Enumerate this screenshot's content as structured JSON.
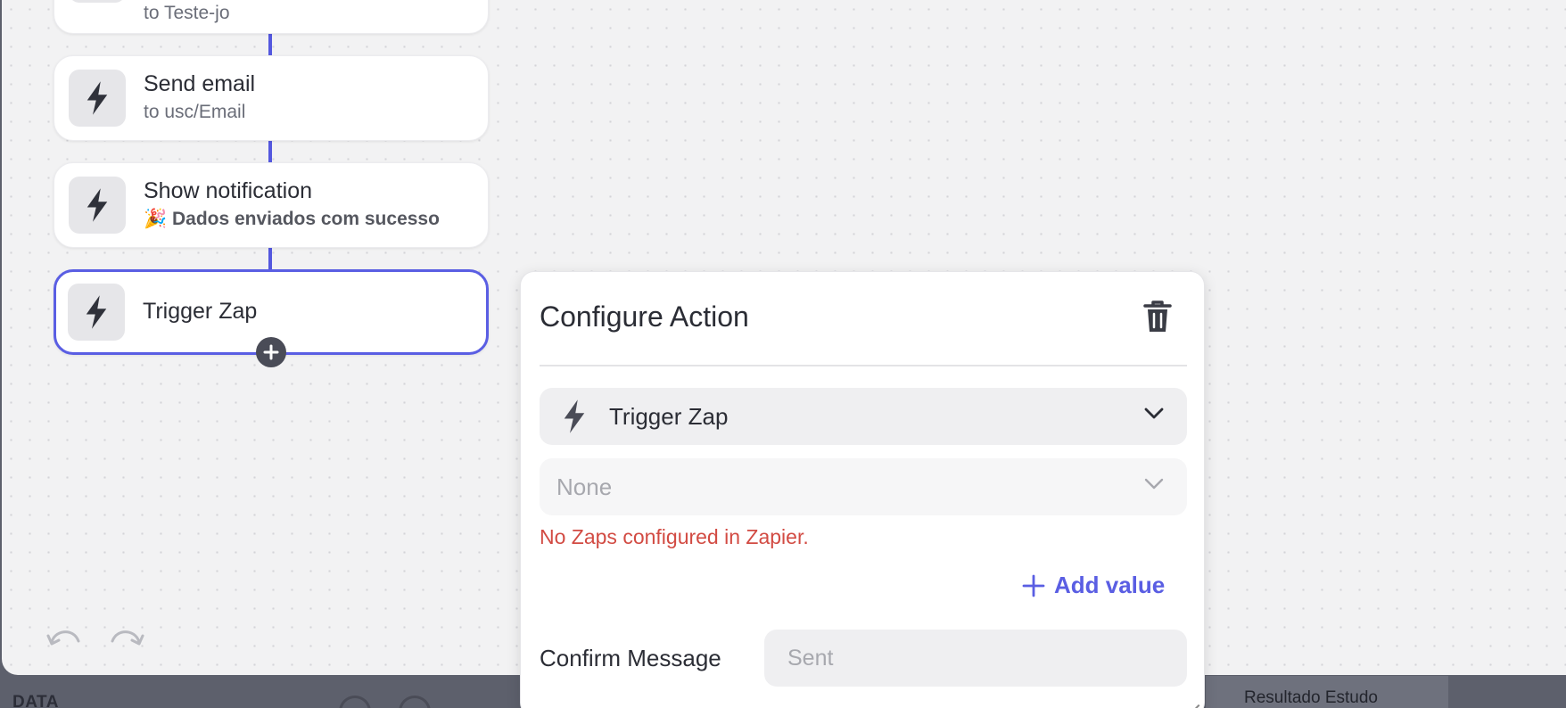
{
  "canvas": {
    "nodes": [
      {
        "title": "",
        "subtitle": "to Teste-jo"
      },
      {
        "title": "Send email",
        "subtitle": "to usc/Email"
      },
      {
        "title": "Show notification",
        "subtitle": "🎉 Dados enviados com sucesso"
      },
      {
        "title": "Trigger Zap",
        "subtitle": ""
      }
    ],
    "icons": {
      "node_icon": "bolt-icon",
      "add": "plus-circle-icon",
      "undo": "undo-icon",
      "redo": "redo-icon"
    }
  },
  "background": {
    "section_label": "DATA",
    "right_label": "Resultado Estudo"
  },
  "panel": {
    "title": "Configure Action",
    "action_select": {
      "value": "Trigger Zap"
    },
    "zap_select": {
      "value": "None"
    },
    "error": "No Zaps configured in Zapier.",
    "add_value": "Add value",
    "confirm_label": "Confirm Message",
    "confirm_placeholder": "Sent"
  },
  "colors": {
    "accent": "#5a5ee3",
    "error": "#d24b43",
    "text": "#2b2d35"
  }
}
